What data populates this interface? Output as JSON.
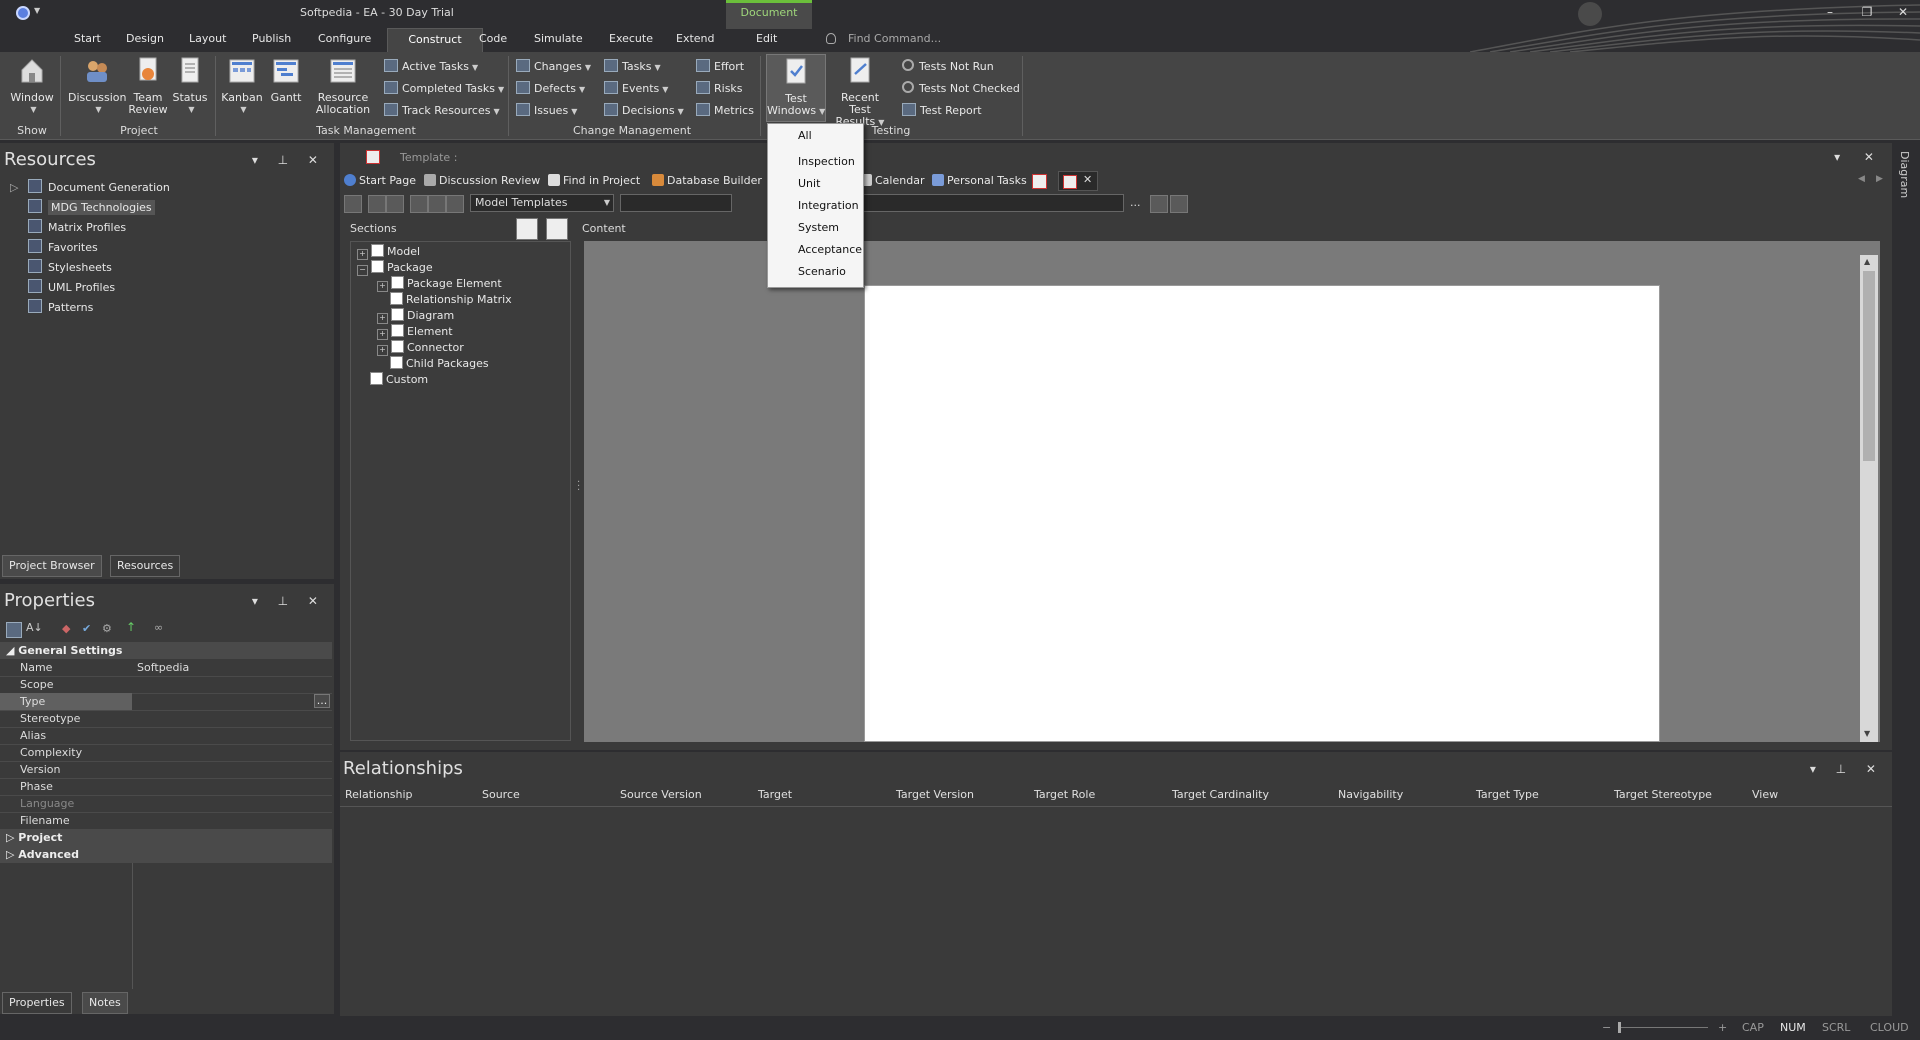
{
  "title_bar": {
    "title": "Softpedia - EA - 30 Day Trial",
    "contextual_group": "Document",
    "min": "–",
    "restore": "❐",
    "close": "✕"
  },
  "menu": {
    "items": [
      "Start",
      "Design",
      "Layout",
      "Publish",
      "Configure",
      "Construct",
      "Code",
      "Simulate",
      "Execute",
      "Extend",
      "Edit"
    ],
    "active": "Construct",
    "find_placeholder": "Find Command..."
  },
  "ribbon": {
    "show": {
      "window": "Window",
      "label": "Show"
    },
    "project": {
      "discussion": "Discussion",
      "team_review_1": "Team",
      "team_review_2": "Review",
      "status": "Status",
      "label": "Project"
    },
    "task_management": {
      "kanban": "Kanban",
      "gantt": "Gantt",
      "resource_allocation_1": "Resource",
      "resource_allocation_2": "Allocation",
      "active_tasks": "Active Tasks",
      "completed_tasks": "Completed Tasks",
      "track_resources": "Track Resources",
      "label": "Task Management"
    },
    "change_management": {
      "changes": "Changes",
      "defects": "Defects",
      "issues": "Issues",
      "tasks": "Tasks",
      "events": "Events",
      "decisions": "Decisions",
      "effort": "Effort",
      "risks": "Risks",
      "metrics": "Metrics",
      "label": "Change Management"
    },
    "testing": {
      "test_windows_1": "Test",
      "test_windows_2": "Windows",
      "recent_results_1": "Recent Test",
      "recent_results_2": "Results",
      "tests_not_run": "Tests Not Run",
      "tests_not_checked": "Tests Not Checked",
      "test_report": "Test Report",
      "label": "Testing"
    }
  },
  "test_windows_menu": [
    "All",
    "Inspection",
    "Unit",
    "Integration",
    "System",
    "Acceptance",
    "Scenario"
  ],
  "resources_panel": {
    "title": "Resources",
    "items": [
      "Document Generation",
      "MDG Technologies",
      "Matrix Profiles",
      "Favorites",
      "Stylesheets",
      "UML Profiles",
      "Patterns"
    ],
    "selected": "MDG Technologies",
    "tabs": [
      "Project Browser",
      "Resources"
    ]
  },
  "properties_panel": {
    "title": "Properties",
    "group_general": "General Settings",
    "rows": [
      {
        "k": "Name",
        "v": "Softpedia"
      },
      {
        "k": "Scope",
        "v": ""
      },
      {
        "k": "Type",
        "v": ""
      },
      {
        "k": "Stereotype",
        "v": ""
      },
      {
        "k": "Alias",
        "v": ""
      },
      {
        "k": "Complexity",
        "v": ""
      },
      {
        "k": "Version",
        "v": ""
      },
      {
        "k": "Phase",
        "v": ""
      },
      {
        "k": "Language",
        "v": ""
      },
      {
        "k": "Filename",
        "v": ""
      }
    ],
    "type_ellipsis": "...",
    "group_project": "Project",
    "group_advanced": "Advanced",
    "tabs": [
      "Properties",
      "Notes"
    ]
  },
  "document": {
    "breadcrumb": "Template :",
    "tabs": [
      "Start Page",
      "Discussion Review",
      "Find in Project",
      "Database Builder",
      "Calendar",
      "Personal Tasks"
    ],
    "template_combo": "Model Templates",
    "ellipsis": "...",
    "sections_label": "Sections",
    "content_label": "Content",
    "sections": [
      {
        "label": "Model",
        "level": 0,
        "expander": "+"
      },
      {
        "label": "Package",
        "level": 0,
        "expander": "−"
      },
      {
        "label": "Package Element",
        "level": 1,
        "expander": "+"
      },
      {
        "label": "Relationship Matrix",
        "level": 1,
        "expander": ""
      },
      {
        "label": "Diagram",
        "level": 1,
        "expander": "+"
      },
      {
        "label": "Element",
        "level": 1,
        "expander": "+"
      },
      {
        "label": "Connector",
        "level": 1,
        "expander": "+"
      },
      {
        "label": "Child Packages",
        "level": 1,
        "expander": ""
      },
      {
        "label": "Custom",
        "level": 0,
        "expander": ""
      }
    ],
    "side_tab": "Diagram"
  },
  "relationships_panel": {
    "title": "Relationships",
    "columns": [
      "Relationship",
      "Source",
      "Source Version",
      "Target",
      "Target Version",
      "Target Role",
      "Target Cardinality",
      "Navigability",
      "Target Type",
      "Target Stereotype",
      "View"
    ]
  },
  "status_bar": {
    "minus": "−",
    "plus": "+",
    "cap": "CAP",
    "num": "NUM",
    "scrl": "SCRL",
    "cloud": "CLOUD"
  },
  "colors": {
    "accent_green": "#6bbf3b",
    "ribbon_bg": "#454545",
    "panel_bg": "#3a3a3a",
    "title_bg": "#2d2d30"
  }
}
